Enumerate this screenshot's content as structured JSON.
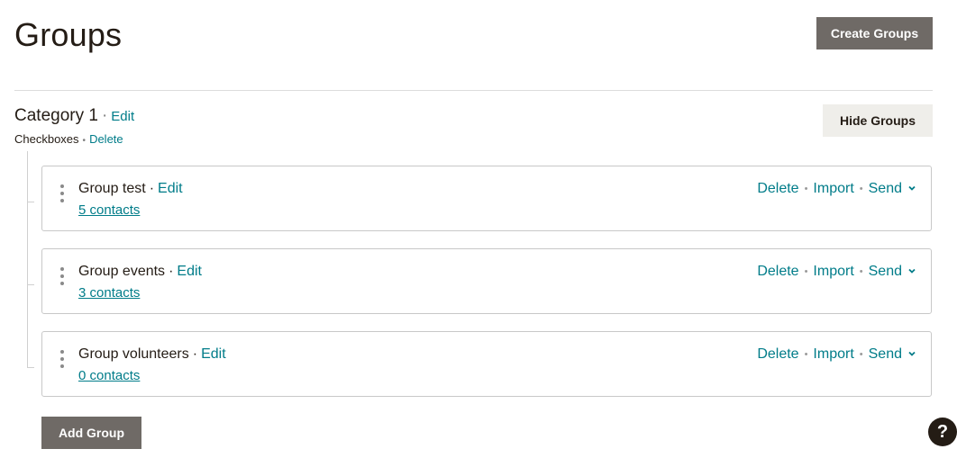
{
  "page": {
    "title": "Groups"
  },
  "toolbar": {
    "create_label": "Create Groups"
  },
  "category": {
    "name": "Category 1",
    "edit_label": "Edit",
    "type": "Checkboxes",
    "delete_label": "Delete",
    "hide_label": "Hide Groups"
  },
  "groups": [
    {
      "name": "Group test",
      "edit_label": "Edit",
      "contacts": "5 contacts",
      "delete_label": "Delete",
      "import_label": "Import",
      "send_label": "Send"
    },
    {
      "name": "Group events",
      "edit_label": "Edit",
      "contacts": "3 contacts",
      "delete_label": "Delete",
      "import_label": "Import",
      "send_label": "Send"
    },
    {
      "name": "Group volunteers",
      "edit_label": "Edit",
      "contacts": "0 contacts",
      "delete_label": "Delete",
      "import_label": "Import",
      "send_label": "Send"
    }
  ],
  "footer": {
    "add_label": "Add Group",
    "help_label": "?"
  },
  "colors": {
    "link": "#007c89",
    "dark_button": "#6f6a66",
    "light_button": "#efeeea",
    "text": "#241c15"
  },
  "icons": {
    "drag": "drag-handle-icon",
    "chevron": "chevron-down-icon",
    "help": "help-icon"
  }
}
